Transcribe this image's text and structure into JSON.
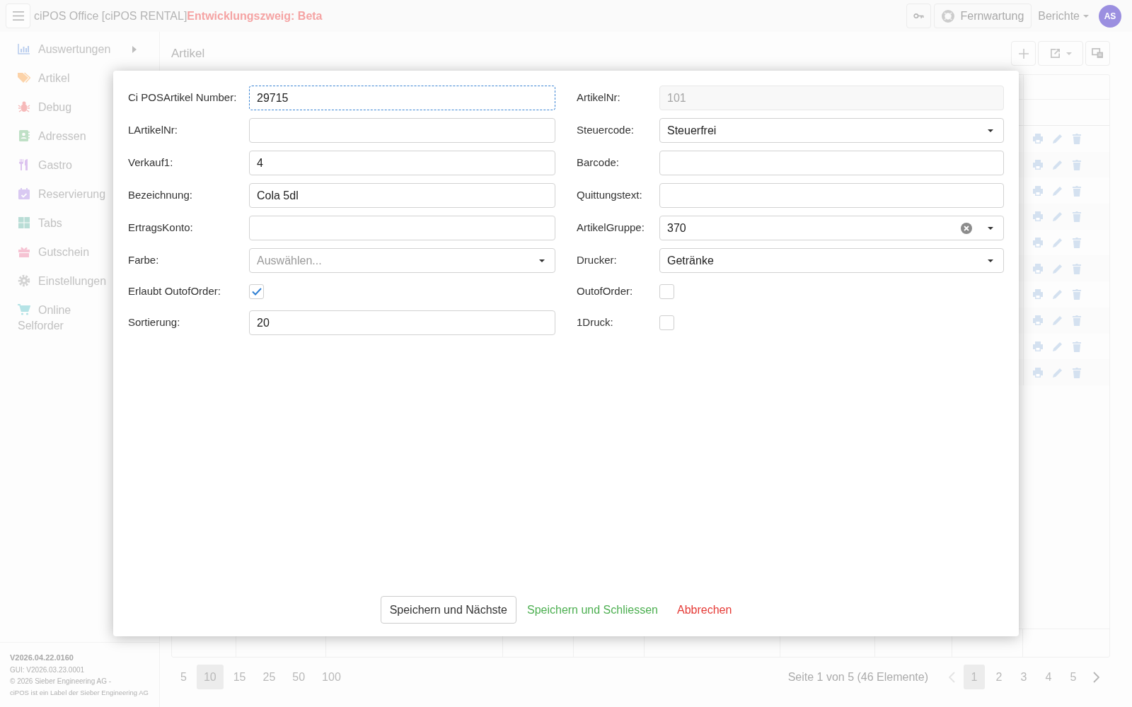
{
  "app_bar": {
    "title": "ciPOS Office [ciPOS RENTAL]",
    "branch": "Entwicklungszweig: Beta",
    "remote_button": "Fernwartung",
    "reports_menu": "Berichte",
    "avatar": "AS"
  },
  "sidebar": {
    "items": [
      {
        "label": "Auswertungen",
        "submenu": true
      },
      {
        "label": "Artikel"
      },
      {
        "label": "Debug"
      },
      {
        "label": "Adressen"
      },
      {
        "label": "Gastro"
      },
      {
        "label": "Reservierung"
      },
      {
        "label": "Tabs"
      },
      {
        "label": "Gutschein"
      },
      {
        "label": "Einstellungen"
      },
      {
        "label": "Online Selforder"
      }
    ],
    "footer": {
      "version": "V2026.04.22.0160",
      "gui_version": "GUI: V2026.03.23.0001",
      "copyright": "© 2026 Sieber Engineering AG -",
      "label_note": "ciPOS ist ein Label der Sieber Engineering AG"
    }
  },
  "page": {
    "title": "Artikel"
  },
  "pagination": {
    "page_sizes": [
      {
        "label": "5",
        "selected": false
      },
      {
        "label": "10",
        "selected": true
      },
      {
        "label": "15",
        "selected": false
      },
      {
        "label": "25",
        "selected": false
      },
      {
        "label": "50",
        "selected": false
      },
      {
        "label": "100",
        "selected": false
      }
    ],
    "summary": "Seite 1 von 5 (46 Elemente)",
    "previous": {
      "disabled": true
    },
    "pages": [
      {
        "label": "1",
        "selected": true
      },
      {
        "label": "2",
        "selected": false
      },
      {
        "label": "3",
        "selected": false
      },
      {
        "label": "4",
        "selected": false
      },
      {
        "label": "5",
        "selected": false
      }
    ],
    "next": {
      "disabled": false
    }
  },
  "dialog": {
    "rows": [
      {
        "left": {
          "kind": "text",
          "label": "Ci POSArtikel Number:",
          "value": "29715",
          "focused": true,
          "disabled": false
        },
        "right": {
          "kind": "text",
          "label": "ArtikelNr:",
          "value": "101",
          "focused": false,
          "disabled": true
        }
      },
      {
        "left": {
          "kind": "text",
          "label": "LArtikelNr:",
          "focused": false,
          "disabled": false
        },
        "right": {
          "kind": "select",
          "label": "Steuercode:",
          "value": "Steuerfrei",
          "clearable": false
        }
      },
      {
        "left": {
          "kind": "text",
          "label": "Verkauf1:",
          "value": "4",
          "focused": false,
          "disabled": false
        },
        "right": {
          "kind": "text",
          "label": "Barcode:",
          "focused": false,
          "disabled": false
        }
      },
      {
        "left": {
          "kind": "text",
          "label": "Bezeichnung:",
          "value": "Cola 5dl",
          "focused": false,
          "disabled": false
        },
        "right": {
          "kind": "text",
          "label": "Quittungstext:",
          "focused": false,
          "disabled": false
        }
      },
      {
        "left": {
          "kind": "text",
          "label": "ErtragsKonto:",
          "focused": false,
          "disabled": false
        },
        "right": {
          "kind": "select",
          "label": "ArtikelGruppe:",
          "value": "370",
          "clearable": true
        }
      },
      {
        "left": {
          "kind": "select",
          "label": "Farbe:",
          "placeholder": "Auswählen...",
          "clearable": false
        },
        "right": {
          "kind": "select",
          "label": "Drucker:",
          "value": "Getränke",
          "clearable": false
        }
      },
      {
        "left": {
          "kind": "checkbox",
          "label": "Erlaubt OutofOrder:",
          "checked": true
        },
        "right": {
          "kind": "checkbox",
          "label": "OutofOrder:",
          "checked": false
        }
      },
      {
        "left": {
          "kind": "text",
          "label": "Sortierung:",
          "value": "20",
          "focused": false,
          "disabled": false
        },
        "right": {
          "kind": "checkbox",
          "label": "1Druck:",
          "checked": false
        }
      }
    ],
    "buttons": [
      {
        "kind": "outline",
        "label": "Speichern und Nächste"
      },
      {
        "kind": "success",
        "label": "Speichern und Schliessen"
      },
      {
        "kind": "danger",
        "label": "Abbrechen"
      }
    ]
  }
}
